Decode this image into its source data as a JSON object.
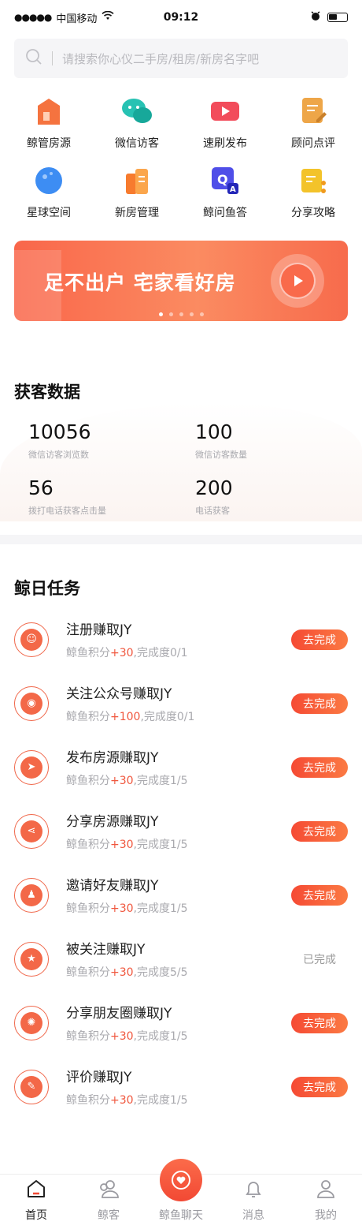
{
  "status": {
    "carrier": "中国移动",
    "time": "09:12"
  },
  "search": {
    "placeholder": "请搜索你心仪二手房/租房/新房名字吧"
  },
  "grid": [
    {
      "label": "鲸管房源",
      "icon": "house-icon",
      "color": "#f5733f"
    },
    {
      "label": "微信访客",
      "icon": "wechat-icon",
      "color": "#27c2b3"
    },
    {
      "label": "速刷发布",
      "icon": "video-icon",
      "color": "#f24c5b"
    },
    {
      "label": "顾问点评",
      "icon": "comment-icon",
      "color": "#eea648"
    },
    {
      "label": "星球空间",
      "icon": "planet-icon",
      "color": "#3d8df3"
    },
    {
      "label": "新房管理",
      "icon": "building-icon",
      "color": "#f77b2e"
    },
    {
      "label": "鲸问鱼答",
      "icon": "qa-icon",
      "color": "#4f4ee8"
    },
    {
      "label": "分享攻略",
      "icon": "share-doc-icon",
      "color": "#f3c32a"
    }
  ],
  "banner": {
    "text": "足不出户 宅家看好房",
    "slides": 5,
    "active": 0
  },
  "stats": {
    "title": "获客数据",
    "items": [
      {
        "value": "10056",
        "label": "微信访客浏览数"
      },
      {
        "value": "100",
        "label": "微信访客数量"
      },
      {
        "value": "56",
        "label": "拨打电话获客点击量"
      },
      {
        "value": "200",
        "label": "电话获客"
      }
    ]
  },
  "tasks": {
    "title": "鲸日任务",
    "items": [
      {
        "name": "注册赚取JY",
        "prefix": "鲸鱼积分",
        "points": "+30",
        "progress": ",完成度0/1",
        "action": "去完成",
        "done": false,
        "icon": "user-add-icon",
        "glyph": "☺"
      },
      {
        "name": "关注公众号赚取JY",
        "prefix": "鲸鱼积分",
        "points": "+100",
        "progress": ",完成度0/1",
        "action": "去完成",
        "done": false,
        "icon": "wechat-icon",
        "glyph": "◉"
      },
      {
        "name": "发布房源赚取JY",
        "prefix": "鲸鱼积分",
        "points": "+30",
        "progress": ",完成度1/5",
        "action": "去完成",
        "done": false,
        "icon": "send-icon",
        "glyph": "➤"
      },
      {
        "name": "分享房源赚取JY",
        "prefix": "鲸鱼积分",
        "points": "+30",
        "progress": ",完成度1/5",
        "action": "去完成",
        "done": false,
        "icon": "share-icon",
        "glyph": "⋖"
      },
      {
        "name": "邀请好友赚取JY",
        "prefix": "鲸鱼积分",
        "points": "+30",
        "progress": ",完成度1/5",
        "action": "去完成",
        "done": false,
        "icon": "group-icon",
        "glyph": "♟"
      },
      {
        "name": "被关注赚取JY",
        "prefix": "鲸鱼积分",
        "points": "+30",
        "progress": ",完成度5/5",
        "action": "已完成",
        "done": true,
        "icon": "user-star-icon",
        "glyph": "★"
      },
      {
        "name": "分享朋友圈赚取JY",
        "prefix": "鲸鱼积分",
        "points": "+30",
        "progress": ",完成度1/5",
        "action": "去完成",
        "done": false,
        "icon": "moments-icon",
        "glyph": "✺"
      },
      {
        "name": "评价赚取JY",
        "prefix": "鲸鱼积分",
        "points": "+30",
        "progress": ",完成度1/5",
        "action": "去完成",
        "done": false,
        "icon": "edit-icon",
        "glyph": "✎"
      }
    ]
  },
  "tabbar": [
    {
      "label": "首页",
      "icon": "home-icon",
      "active": true
    },
    {
      "label": "鲸客",
      "icon": "clients-icon",
      "active": false
    },
    {
      "label": "鲸鱼聊天",
      "icon": "chat-heart-icon",
      "active": false,
      "center": true
    },
    {
      "label": "消息",
      "icon": "bell-icon",
      "active": false
    },
    {
      "label": "我的",
      "icon": "profile-icon",
      "active": false
    }
  ]
}
